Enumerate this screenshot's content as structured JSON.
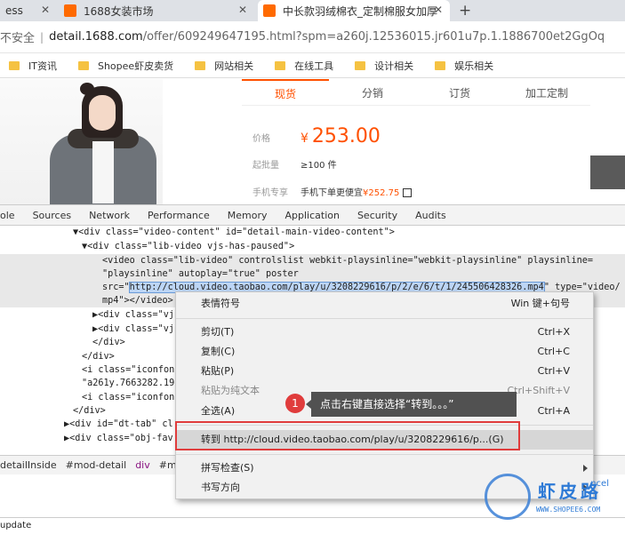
{
  "browser": {
    "tabs": [
      {
        "title": "ess",
        "favicon": "none"
      },
      {
        "title": "1688女装市场",
        "favicon": "1688-icon"
      },
      {
        "title": "中长款羽绒棉衣_定制棉服女加厚",
        "favicon": "1688-icon",
        "active": true
      }
    ],
    "new_tab": "+",
    "address": {
      "security": "不安全",
      "domain": "detail.1688.com",
      "path": "/offer/609249647195.html?spm=a260j.12536015.jr601u7p.1.1886700et2GgOq"
    },
    "bookmarks": [
      "IT资讯",
      "Shopee虾皮卖货",
      "网站相关",
      "在线工具",
      "设计相关",
      "娱乐相关"
    ],
    "folder_color": "#f5c242"
  },
  "product": {
    "tabs": [
      "现货",
      "分销",
      "订货",
      "加工定制"
    ],
    "active_tab": "现货",
    "price_label": "价格",
    "currency": "¥",
    "price": "253.00",
    "moq_label": "起批量",
    "moq": "≥100 件",
    "mobile_label": "手机专享",
    "mobile_text": "手机下单更便宜",
    "mobile_price": "¥252.75",
    "accent": "#ff5000"
  },
  "devtools": {
    "tabs": [
      "ole",
      "Sources",
      "Network",
      "Performance",
      "Memory",
      "Application",
      "Security",
      "Audits"
    ],
    "code_lines": [
      {
        "t": "▼<div class=\"video-content\" id=\"detail-main-video-content\">"
      },
      {
        "t": "▼<div class=\"lib-video vjs-has-paused\">"
      },
      {
        "t": "<video class=\"lib-video\" controlslist webkit-playsinline=\"webkit-playsinline\" playsinline="
      },
      {
        "t": "\"playsinline\" autoplay=\"true\" poster"
      },
      {
        "t_pre": "src=\"",
        "t_hl": "http://cloud.video.taobao.com/play/u/3208229616/p/2/e/6/t/1/245506428326.mp4",
        "t_post": "\" type=\"video/"
      },
      {
        "t": "mp4\"></video>"
      },
      {
        "t": "▶<div class=\"vj"
      },
      {
        "t": "▶<div class=\"vj"
      },
      {
        "t": "</div>"
      },
      {
        "t": "</div>"
      },
      {
        "t": "<i class=\"iconfon"
      },
      {
        "t": "\"a261y.7663282.19"
      },
      {
        "t": "<i class=\"iconfon"
      },
      {
        "t": "</div>"
      },
      {
        "t": "▶<div id=\"dt-tab\" cl"
      },
      {
        "t": "▶<div class=\"obj-fav"
      }
    ],
    "breadcrumbs": [
      "detailInside",
      "#mod-detail",
      "div",
      "#mod-"
    ],
    "status": "update"
  },
  "context_menu": {
    "items": [
      {
        "label": "表情符号",
        "shortcut": "Win 键+句号"
      },
      {
        "label": "剪切(T)",
        "shortcut": "Ctrl+X"
      },
      {
        "label": "复制(C)",
        "shortcut": "Ctrl+C"
      },
      {
        "label": "粘贴(P)",
        "shortcut": "Ctrl+V"
      },
      {
        "label": "粘贴为纯文本",
        "shortcut": "Ctrl+Shift+V",
        "disabled": true
      },
      {
        "label": "全选(A)",
        "shortcut": "Ctrl+A"
      },
      {
        "label": "转到 http://cloud.video.taobao.com/play/u/3208229616/p...(G)",
        "shortcut": ""
      },
      {
        "label": "拼写检查(S)",
        "shortcut": ""
      },
      {
        "label": "书写方向",
        "shortcut": ""
      }
    ]
  },
  "annotation": {
    "number": "1",
    "text": "点击右键直接选择“转到。。。”",
    "color": "#e03c3c"
  },
  "watermark": {
    "brand": "虾皮路",
    "url": "WWW.SHOPEE6.COM",
    "trailing": "ncel",
    "color": "#2d7ad6"
  }
}
